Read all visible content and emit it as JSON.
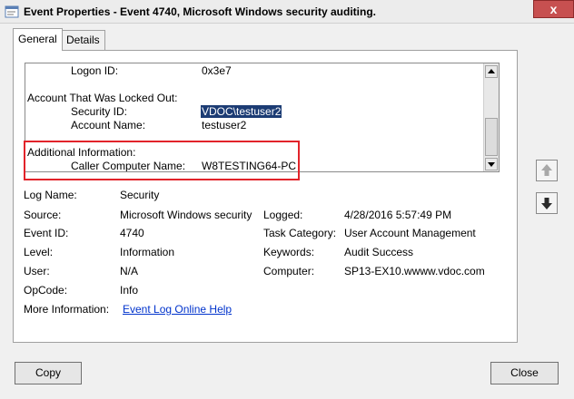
{
  "window": {
    "title": "Event Properties - Event 4740, Microsoft Windows security auditing.",
    "close_glyph": "x"
  },
  "tabs": [
    {
      "label": "General"
    },
    {
      "label": "Details"
    }
  ],
  "description": {
    "logon_id_label": "Logon ID:",
    "logon_id_value": "0x3e7",
    "locked_heading": "Account That Was Locked Out:",
    "security_id_label": "Security ID:",
    "security_id_value": "VDOC\\testuser2",
    "account_name_label": "Account Name:",
    "account_name_value": "testuser2",
    "additional_heading": "Additional Information:",
    "caller_label": "Caller Computer Name:",
    "caller_value": "W8TESTING64-PC"
  },
  "fields": {
    "log_name_label": "Log Name:",
    "log_name_value": "Security",
    "source_label": "Source:",
    "source_value": "Microsoft Windows security",
    "logged_label": "Logged:",
    "logged_value": "4/28/2016 5:57:49 PM",
    "event_id_label": "Event ID:",
    "event_id_value": "4740",
    "task_category_label": "Task Category:",
    "task_category_value": "User Account Management",
    "level_label": "Level:",
    "level_value": "Information",
    "keywords_label": "Keywords:",
    "keywords_value": "Audit Success",
    "user_label": "User:",
    "user_value": "N/A",
    "computer_label": "Computer:",
    "computer_value": "SP13-EX10.wwww.vdoc.com",
    "opcode_label": "OpCode:",
    "opcode_value": "Info",
    "more_info_label": "More Information:",
    "more_info_link": "Event Log Online Help"
  },
  "buttons": {
    "copy": "Copy",
    "close": "Close"
  },
  "colors": {
    "selection": "#1c3c74",
    "highlight_box": "#e2232a",
    "link": "#0033cc"
  }
}
